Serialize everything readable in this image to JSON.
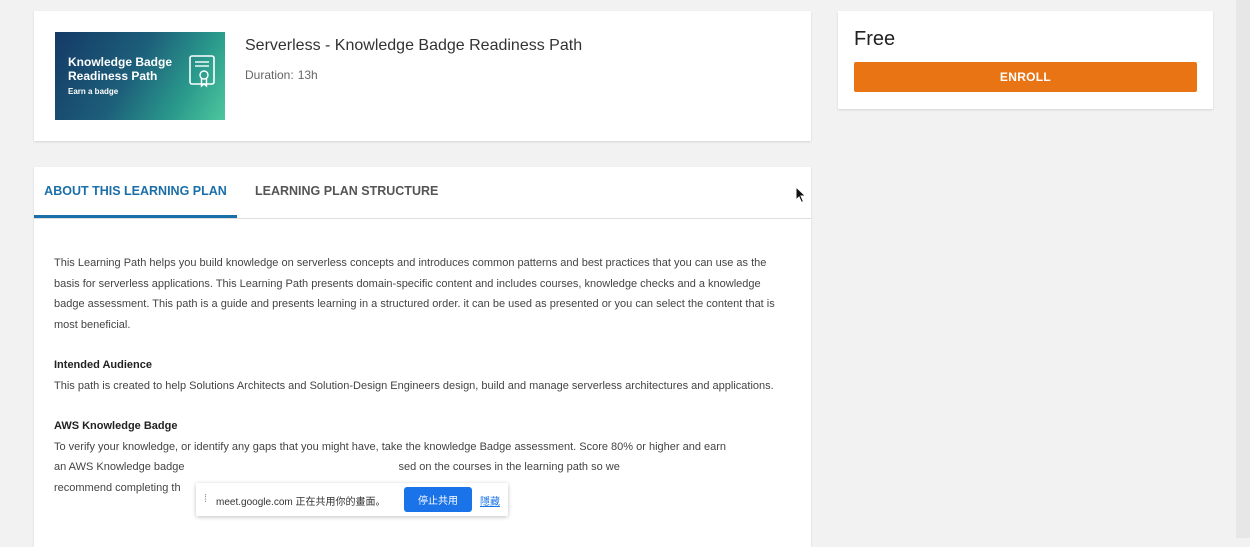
{
  "course": {
    "thumbnail": {
      "title": "Knowledge Badge Readiness Path",
      "subtitle": "Earn a badge",
      "icon": "certificate-badge-icon",
      "gradient": [
        "#143a66",
        "#2a9a8c",
        "#4ec79e"
      ]
    },
    "title": "Serverless - Knowledge Badge Readiness Path",
    "duration_label": "Duration:",
    "duration_value": "13h"
  },
  "price_panel": {
    "price": "Free",
    "enroll_label": "ENROLL",
    "enroll_color": "#e87413"
  },
  "tabs": [
    {
      "label": "ABOUT THIS LEARNING PLAN",
      "active": true
    },
    {
      "label": "LEARNING PLAN STRUCTURE",
      "active": false
    }
  ],
  "about": {
    "intro": "This Learning Path helps you build knowledge on serverless concepts and introduces common patterns and best practices that you can use as the basis for serverless applications. This Learning Path presents domain-specific content and includes courses, knowledge checks and a knowledge badge assessment. This path is a guide and presents learning in a structured order. it can be used as presented or you can select the content that is most beneficial.",
    "audience_heading": "Intended Audience",
    "audience_text": "This path is created to help Solutions Architects and Solution-Design Engineers design, build and manage serverless architectures and applications.",
    "badge_heading": "AWS Knowledge Badge",
    "badge_text_line1": "To verify your knowledge, or identify any gaps that you might have, take the knowledge Badge assessment. Score 80% or higher and earn",
    "badge_text_line2": "an AWS Knowledge badge",
    "badge_text_line2_end": "sed on the courses in the learning path so we",
    "badge_text_line3": "recommend completing th"
  },
  "share_bar": {
    "message": "meet.google.com 正在共用你的畫面。",
    "stop_label": "停止共用",
    "hide_label": "隱藏",
    "accent": "#1a73e8"
  },
  "colors": {
    "accent_blue": "#1b6fa8",
    "page_background": "#f2f2f2"
  }
}
